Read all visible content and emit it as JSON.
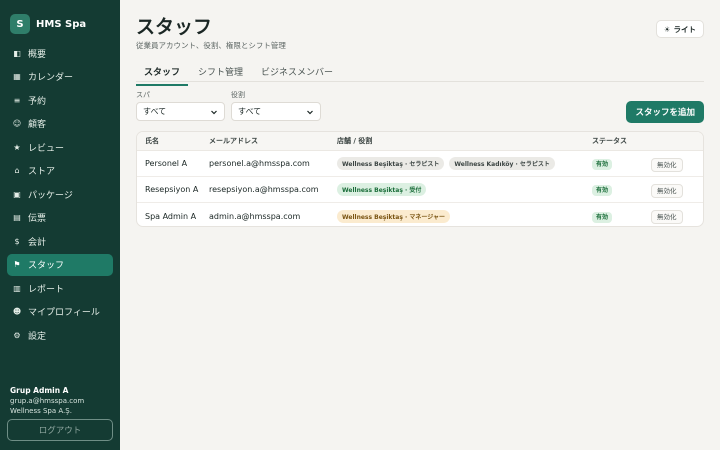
{
  "brand": {
    "logo_letter": "S",
    "name": "HMS Spa"
  },
  "nav": [
    {
      "label": "概要",
      "icon": "◧",
      "icon_name": "overview-icon"
    },
    {
      "label": "カレンダー",
      "icon": "▦",
      "icon_name": "calendar-icon"
    },
    {
      "label": "予約",
      "icon": "≡",
      "icon_name": "booking-icon"
    },
    {
      "label": "顧客",
      "icon": "☺",
      "icon_name": "customers-icon"
    },
    {
      "label": "レビュー",
      "icon": "★",
      "icon_name": "review-icon"
    },
    {
      "label": "ストア",
      "icon": "⌂",
      "icon_name": "store-icon"
    },
    {
      "label": "パッケージ",
      "icon": "▣",
      "icon_name": "package-icon"
    },
    {
      "label": "伝票",
      "icon": "▤",
      "icon_name": "receipt-icon"
    },
    {
      "label": "会計",
      "icon": "$",
      "icon_name": "accounting-icon"
    },
    {
      "label": "スタッフ",
      "icon": "⚑",
      "icon_name": "staff-icon",
      "active": true
    },
    {
      "label": "レポート",
      "icon": "▥",
      "icon_name": "report-icon"
    },
    {
      "label": "マイプロフィール",
      "icon": "☻",
      "icon_name": "profile-icon"
    },
    {
      "label": "設定",
      "icon": "⚙",
      "icon_name": "settings-icon"
    }
  ],
  "user": {
    "name": "Grup Admin A",
    "email": "grup.a@hmsspa.com",
    "company": "Wellness Spa A.Ş."
  },
  "logout_label": "ログアウト",
  "header": {
    "title": "スタッフ",
    "subtitle": "従業員アカウント、役割、権限とシフト管理",
    "theme_label": "ライト",
    "theme_icon": "☀"
  },
  "tabs": [
    {
      "label": "スタッフ",
      "active": true
    },
    {
      "label": "シフト管理"
    },
    {
      "label": "ビジネスメンバー"
    }
  ],
  "filters": {
    "spa_label": "スパ",
    "spa_value": "すべて",
    "role_label": "役割",
    "role_value": "すべて"
  },
  "add_button": "スタッフを追加",
  "table": {
    "headers": [
      "氏名",
      "メールアドレス",
      "店舗 / 役割",
      "ステータス"
    ],
    "rows": [
      {
        "name": "Personel A",
        "email": "personel.a@hmsspa.com",
        "chips": [
          {
            "text": "Wellness Beşiktaş · セラピスト",
            "tone": "gray"
          },
          {
            "text": "Wellness Kadıköy · セラピスト",
            "tone": "gray"
          }
        ],
        "status": "有効",
        "action": "無効化"
      },
      {
        "name": "Resepsiyon A",
        "email": "resepsiyon.a@hmsspa.com",
        "chips": [
          {
            "text": "Wellness Beşiktaş · 受付",
            "tone": "green"
          }
        ],
        "status": "有効",
        "action": "無効化"
      },
      {
        "name": "Spa Admin A",
        "email": "admin.a@hmsspa.com",
        "chips": [
          {
            "text": "Wellness Beşiktaş · マネージャー",
            "tone": "amber"
          }
        ],
        "status": "有効",
        "action": "無効化"
      }
    ]
  }
}
